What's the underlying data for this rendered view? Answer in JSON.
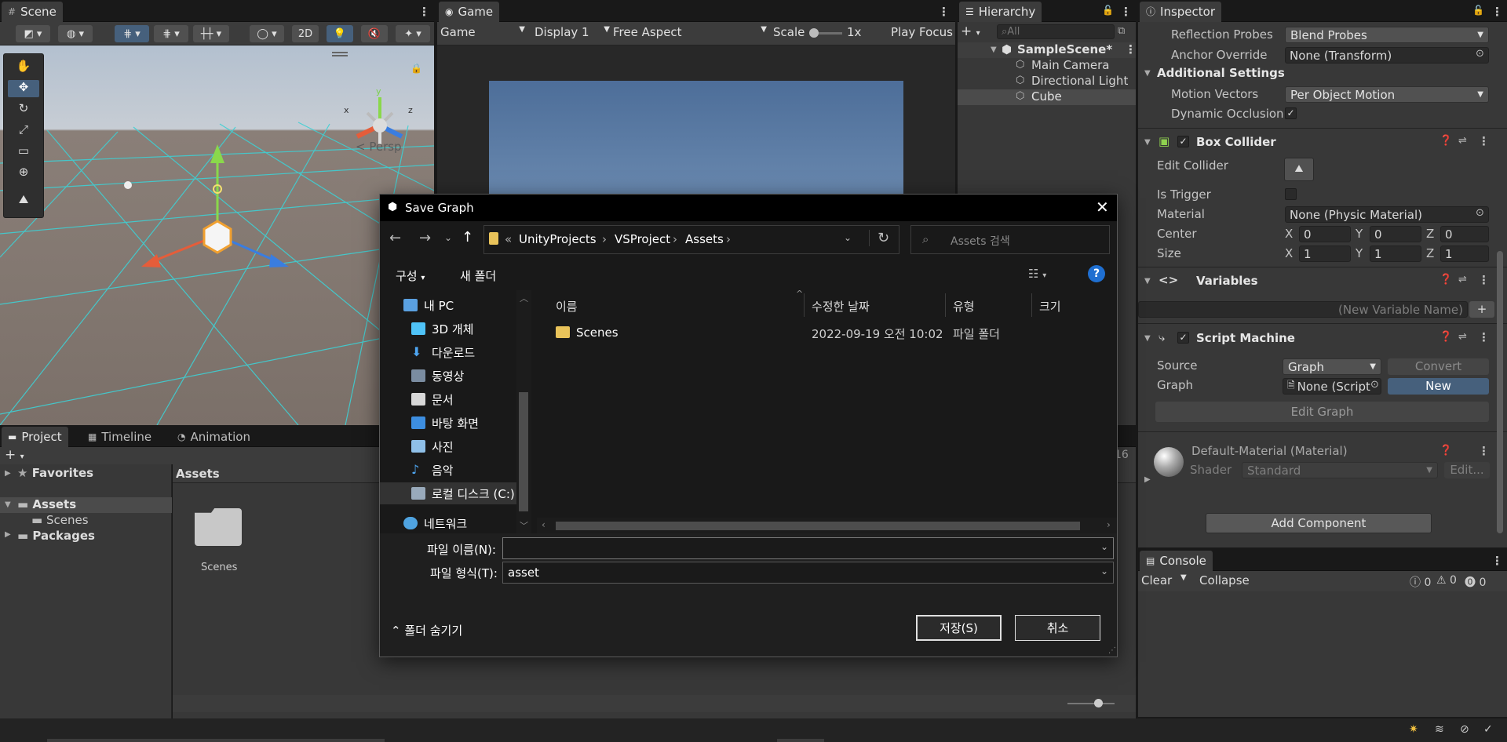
{
  "scene": {
    "tab": "Scene",
    "btn_2d": "2D",
    "persp": "< Persp",
    "gizmo": {
      "y": "y",
      "x": "x",
      "z": "z"
    }
  },
  "game": {
    "tab": "Game",
    "mode": "Game",
    "display": "Display 1",
    "aspect": "Free Aspect",
    "scale_label": "Scale",
    "scale_value": "1x",
    "play_focus": "Play Focus"
  },
  "hierarchy": {
    "tab": "Hierarchy",
    "search_placeholder": "All",
    "scene_name": "SampleScene*",
    "items": [
      "Main Camera",
      "Directional Light",
      "Cube"
    ]
  },
  "inspector": {
    "tab": "Inspector",
    "reflection_probes_label": "Reflection Probes",
    "reflection_probes_value": "Blend Probes",
    "anchor_override_label": "Anchor Override",
    "anchor_override_value": "None (Transform)",
    "additional_settings": "Additional Settings",
    "motion_vectors_label": "Motion Vectors",
    "motion_vectors_value": "Per Object Motion",
    "dynamic_occlusion_label": "Dynamic Occlusion",
    "box_collider": "Box Collider",
    "edit_collider": "Edit Collider",
    "is_trigger": "Is Trigger",
    "material_label": "Material",
    "material_value": "None (Physic Material)",
    "center_label": "Center",
    "size_label": "Size",
    "x": "X",
    "y": "Y",
    "z": "Z",
    "center": [
      "0",
      "0",
      "0"
    ],
    "size": [
      "1",
      "1",
      "1"
    ],
    "variables": "Variables",
    "new_variable_placeholder": "(New Variable Name)",
    "script_machine": "Script Machine",
    "source_label": "Source",
    "source_value": "Graph",
    "convert": "Convert",
    "graph_label": "Graph",
    "graph_value": "None (Script",
    "new_btn": "New",
    "edit_graph": "Edit Graph",
    "material_name": "Default-Material (Material)",
    "shader_label": "Shader",
    "shader_value": "Standard",
    "edit_shader": "Edit...",
    "add_component": "Add Component"
  },
  "project": {
    "tabs": [
      "Project",
      "Timeline",
      "Animation"
    ],
    "favorites": "Favorites",
    "assets": "Assets",
    "scenes": "Scenes",
    "packages": "Packages",
    "breadcrumb": "Assets",
    "folder": "Scenes",
    "count": "16"
  },
  "console": {
    "tab": "Console",
    "clear": "Clear",
    "collapse": "Collapse",
    "counts": [
      "0",
      "0",
      "0"
    ]
  },
  "dialog": {
    "title": "Save Graph",
    "path": [
      "UnityProjects",
      "VSProject",
      "Assets"
    ],
    "path_prefix": "«",
    "search_placeholder": "Assets 검색",
    "organize": "구성",
    "new_folder": "새 폴더",
    "help": "?",
    "columns": [
      "이름",
      "수정한 날짜",
      "유형",
      "크기"
    ],
    "sidebar": [
      "내 PC",
      "3D 개체",
      "다운로드",
      "동영상",
      "문서",
      "바탕 화면",
      "사진",
      "음악",
      "로컬 디스크 (C:)",
      "네트워크"
    ],
    "files": [
      {
        "name": "Scenes",
        "date": "2022-09-19 오전 10:02",
        "type": "파일 폴더"
      }
    ],
    "filename_label": "파일 이름(N):",
    "filename_value": "",
    "filetype_label": "파일 형식(T):",
    "filetype_value": "asset",
    "hide_folders": "폴더 숨기기",
    "save": "저장(S)",
    "cancel": "취소"
  }
}
